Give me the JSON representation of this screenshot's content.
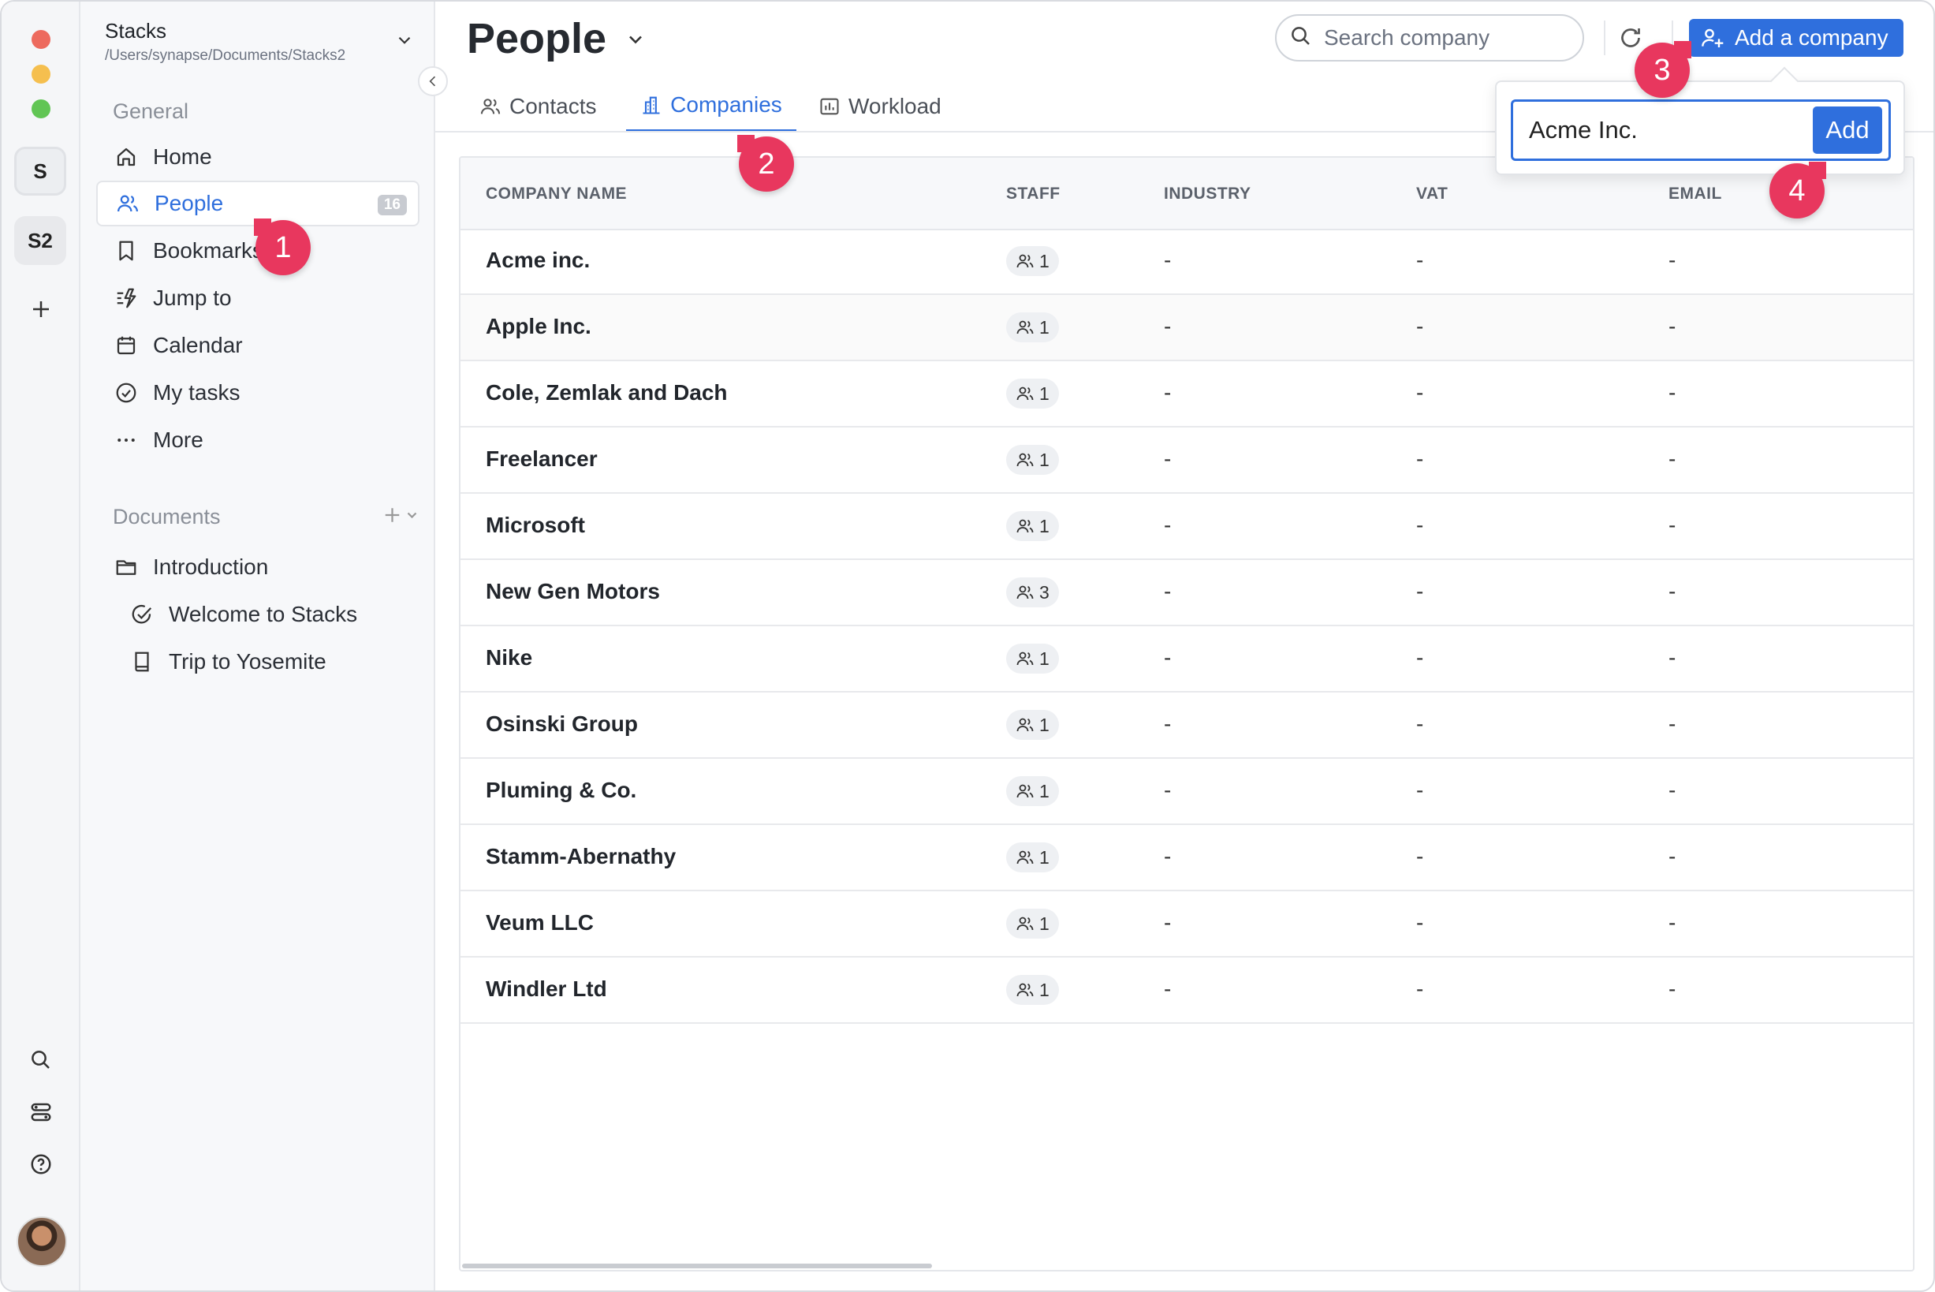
{
  "workspace": {
    "name": "Stacks",
    "path": "/Users/synapse/Documents/Stacks2",
    "rail": [
      "S",
      "S2"
    ]
  },
  "sidebar": {
    "general_label": "General",
    "items": [
      {
        "label": "Home",
        "icon": "home-icon"
      },
      {
        "label": "People",
        "icon": "people-icon",
        "count": "16",
        "active": true
      },
      {
        "label": "Bookmarks",
        "icon": "bookmark-icon"
      },
      {
        "label": "Jump to",
        "icon": "jump-icon"
      },
      {
        "label": "Calendar",
        "icon": "calendar-icon"
      },
      {
        "label": "My tasks",
        "icon": "check-circle-icon"
      },
      {
        "label": "More",
        "icon": "more-icon"
      }
    ],
    "documents_label": "Documents",
    "documents": [
      {
        "label": "Introduction",
        "icon": "folder-icon"
      },
      {
        "label": "Welcome to Stacks",
        "icon": "check-circle-icon"
      },
      {
        "label": "Trip to Yosemite",
        "icon": "book-icon"
      }
    ]
  },
  "header": {
    "title": "People",
    "search_placeholder": "Search company",
    "add_button": "Add a company"
  },
  "tabs": [
    {
      "label": "Contacts",
      "icon": "contacts-icon"
    },
    {
      "label": "Companies",
      "icon": "building-icon",
      "active": true
    },
    {
      "label": "Workload",
      "icon": "chart-icon"
    }
  ],
  "table": {
    "columns": [
      "COMPANY NAME",
      "STAFF",
      "INDUSTRY",
      "VAT",
      "EMAIL"
    ],
    "rows": [
      {
        "name": "Acme inc.",
        "staff": "1",
        "industry": "-",
        "vat": "-",
        "email": "-"
      },
      {
        "name": "Apple Inc.",
        "staff": "1",
        "industry": "-",
        "vat": "-",
        "email": "-"
      },
      {
        "name": "Cole, Zemlak and Dach",
        "staff": "1",
        "industry": "-",
        "vat": "-",
        "email": "-"
      },
      {
        "name": "Freelancer",
        "staff": "1",
        "industry": "-",
        "vat": "-",
        "email": "-"
      },
      {
        "name": "Microsoft",
        "staff": "1",
        "industry": "-",
        "vat": "-",
        "email": "-"
      },
      {
        "name": "New Gen Motors",
        "staff": "3",
        "industry": "-",
        "vat": "-",
        "email": "-"
      },
      {
        "name": "Nike",
        "staff": "1",
        "industry": "-",
        "vat": "-",
        "email": "-"
      },
      {
        "name": "Osinski Group",
        "staff": "1",
        "industry": "-",
        "vat": "-",
        "email": "-"
      },
      {
        "name": "Pluming & Co.",
        "staff": "1",
        "industry": "-",
        "vat": "-",
        "email": "-"
      },
      {
        "name": "Stamm-Abernathy",
        "staff": "1",
        "industry": "-",
        "vat": "-",
        "email": "-"
      },
      {
        "name": "Veum LLC",
        "staff": "1",
        "industry": "-",
        "vat": "-",
        "email": "-"
      },
      {
        "name": "Windler Ltd",
        "staff": "1",
        "industry": "-",
        "vat": "-",
        "email": "-"
      }
    ]
  },
  "popover": {
    "input_value": "Acme Inc.",
    "add_label": "Add"
  },
  "markers": [
    "1",
    "2",
    "3",
    "4"
  ],
  "colors": {
    "accent": "#2f6fdd",
    "marker": "#e8375e",
    "traffic_red": "#ed6a5e",
    "traffic_yellow": "#f5bf4f",
    "traffic_green": "#61c554"
  }
}
